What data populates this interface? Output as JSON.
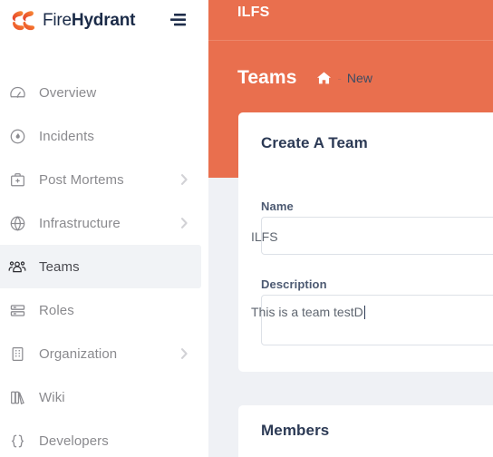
{
  "brand": {
    "name_light": "Fire",
    "name_bold": "Hydrant",
    "logo_icon": "flame-logo-icon",
    "menu_icon": "hamburger-menu-icon",
    "accent_color": "#e96f4e",
    "text_color": "#1b2b48"
  },
  "sidebar": {
    "items": [
      {
        "label": "Overview",
        "icon": "gauge-icon",
        "active": false,
        "expandable": false
      },
      {
        "label": "Incidents",
        "icon": "flame-circle-icon",
        "active": false,
        "expandable": false
      },
      {
        "label": "Post Mortems",
        "icon": "briefcase-plus-icon",
        "active": false,
        "expandable": true
      },
      {
        "label": "Infrastructure",
        "icon": "globe-icon",
        "active": false,
        "expandable": true
      },
      {
        "label": "Teams",
        "icon": "people-icon",
        "active": true,
        "expandable": false
      },
      {
        "label": "Roles",
        "icon": "server-stack-icon",
        "active": false,
        "expandable": false
      },
      {
        "label": "Organization",
        "icon": "building-icon",
        "active": false,
        "expandable": true
      },
      {
        "label": "Wiki",
        "icon": "books-icon",
        "active": false,
        "expandable": false
      },
      {
        "label": "Developers",
        "icon": "curly-braces-icon",
        "active": false,
        "expandable": false
      }
    ],
    "active_bg": "#f1f3f6",
    "inactive_text_color": "#8a8a8e"
  },
  "header": {
    "org_name": "ILFS",
    "page_title": "Teams",
    "breadcrumb": {
      "home_icon": "home-icon",
      "separator": "-",
      "current": "New",
      "current_color": "#3d4c63"
    },
    "background_color": "#e96f4e"
  },
  "main": {
    "background_color": "#eff1f5",
    "create_card": {
      "title": "Create A Team",
      "fields": [
        {
          "label": "Name",
          "value": "ILFS",
          "placeholder": ""
        },
        {
          "label": "Description",
          "value": "This is a team testD",
          "placeholder": "",
          "focused": true
        }
      ]
    },
    "members_card": {
      "title": "Members"
    }
  }
}
